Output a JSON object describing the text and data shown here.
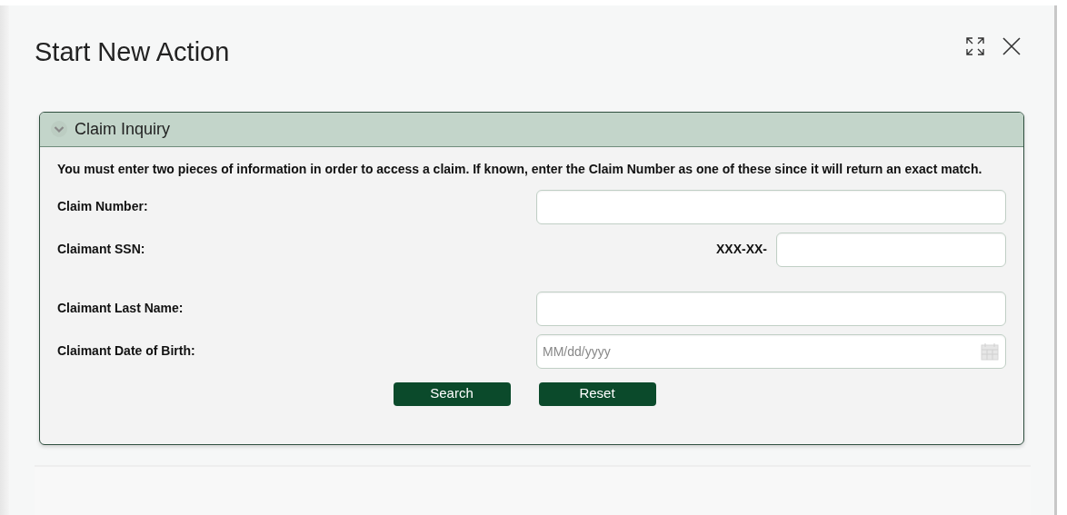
{
  "window": {
    "title": "Start New Action"
  },
  "panel": {
    "title": "Claim Inquiry",
    "expanded": true,
    "instructions": "You must enter two pieces of information in order to access a claim. If known, enter the Claim Number as one of these since it will return an exact match.",
    "fields": [
      {
        "label": "Claim Number:",
        "kind": "text"
      },
      {
        "label": "Claimant SSN:",
        "kind": "ssn",
        "prefix": "XXX-XX-"
      },
      {
        "label": "Claimant Last Name:",
        "kind": "text"
      },
      {
        "label": "Claimant Date of Birth:",
        "kind": "date",
        "placeholder": "MM/dd/yyyy"
      }
    ],
    "buttons": [
      "Search",
      "Reset"
    ]
  }
}
